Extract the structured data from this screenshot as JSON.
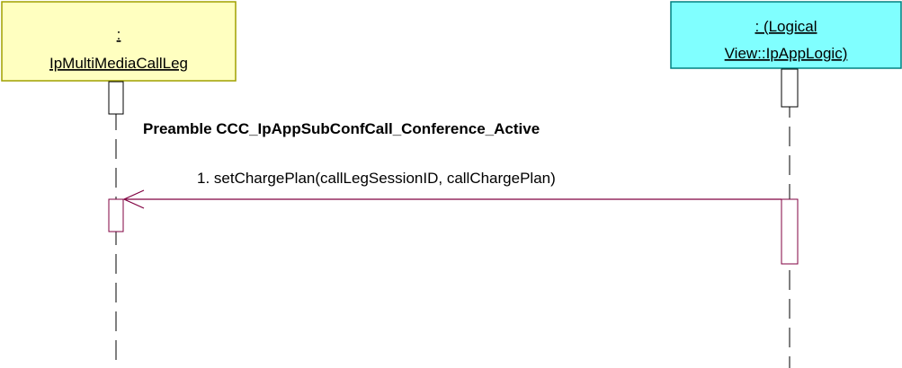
{
  "lifelines": [
    {
      "id": "left",
      "label_line1": ":",
      "label_line2": "IpMultiMediaCallLeg",
      "fill": "#ffffc0"
    },
    {
      "id": "right",
      "label_line1": ": (Logical",
      "label_line2": "View::IpAppLogic)",
      "fill": "#80ffff"
    }
  ],
  "preamble_text": "Preamble CCC_IpAppSubConfCall_Conference_Active",
  "messages": [
    {
      "label": "1. setChargePlan(callLegSessionID, callChargePlan)",
      "from": "right",
      "to": "left",
      "color": "#800040"
    }
  ],
  "colors": {
    "line": "#000000",
    "message": "#800040"
  }
}
